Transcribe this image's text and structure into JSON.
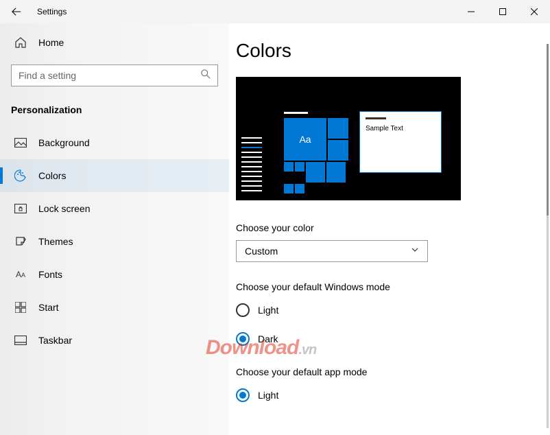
{
  "titlebar": {
    "title": "Settings"
  },
  "sidebar": {
    "home_label": "Home",
    "search_placeholder": "Find a setting",
    "category": "Personalization",
    "items": [
      {
        "id": "background",
        "label": "Background"
      },
      {
        "id": "colors",
        "label": "Colors"
      },
      {
        "id": "lock-screen",
        "label": "Lock screen"
      },
      {
        "id": "themes",
        "label": "Themes"
      },
      {
        "id": "fonts",
        "label": "Fonts"
      },
      {
        "id": "start",
        "label": "Start"
      },
      {
        "id": "taskbar",
        "label": "Taskbar"
      }
    ],
    "active": "colors"
  },
  "main": {
    "title": "Colors",
    "preview_sample_text": "Sample Text",
    "preview_tile_label": "Aa",
    "color_select_label": "Choose your color",
    "color_select_value": "Custom",
    "windows_mode_label": "Choose your default Windows mode",
    "windows_mode_options": [
      {
        "id": "light",
        "label": "Light"
      },
      {
        "id": "dark",
        "label": "Dark"
      }
    ],
    "windows_mode_selected": "dark",
    "app_mode_label": "Choose your default app mode",
    "app_mode_options": [
      {
        "id": "light",
        "label": "Light"
      }
    ],
    "app_mode_selected": "light"
  },
  "watermark": {
    "main": "Download",
    "suffix": ".vn"
  }
}
